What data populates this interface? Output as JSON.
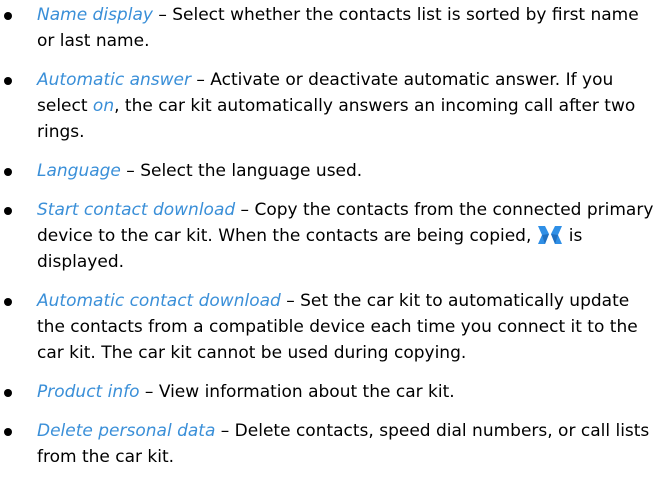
{
  "colors": {
    "term": "#3a8fd8",
    "text": "#000000",
    "icon": "#2f8fe6"
  },
  "icons": {
    "download": "contacts-download-icon"
  },
  "items": [
    {
      "term": "Name display",
      "desc": " – Select whether the contacts list is sorted by first name or last name."
    },
    {
      "term": "Automatic answer",
      "desc_pre": " – Activate or deactivate automatic answer. If you select ",
      "inline_term": "on",
      "desc_post": ", the car kit automatically answers an incoming call after two rings."
    },
    {
      "term": "Language",
      "desc": " – Select the language used."
    },
    {
      "term": "Start contact download",
      "desc_pre": " – Copy the contacts from the connected primary device to the car kit. When the contacts are being copied, ",
      "desc_post": "is displayed."
    },
    {
      "term": "Automatic contact download",
      "desc": " – Set the car kit to automatically update the contacts from a compatible device each time you connect it to the car kit. The car kit cannot be used during copying."
    },
    {
      "term": "Product info",
      "desc": " – View information about the car kit."
    },
    {
      "term": "Delete personal data",
      "desc": " – Delete contacts, speed dial numbers, or call lists from the car kit."
    }
  ]
}
